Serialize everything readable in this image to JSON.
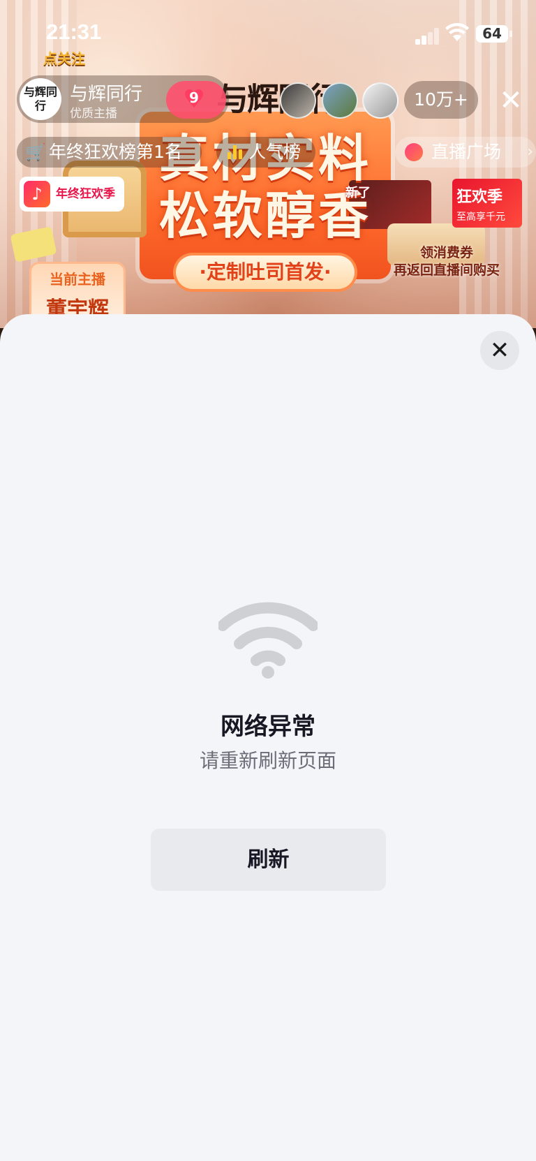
{
  "status_bar": {
    "time": "21:31",
    "battery": "64"
  },
  "live_header": {
    "follow_tag": "点关注",
    "host_name": "与辉同行",
    "host_subtitle": "优质主播",
    "avatar_text": "与辉同行",
    "like_count": "9",
    "viewer_count": "10万+",
    "close_icon": "close-icon"
  },
  "live_pills": {
    "rank": "年终狂欢榜第1名",
    "popularity": "人气榜",
    "plaza": "直播广场"
  },
  "stream_banner": {
    "brand": "与辉同行",
    "line1": "真材实料",
    "line2": "松软醇香",
    "tagline": "·定制吐司首发·",
    "douyin_badge": "年终狂欢季",
    "festival_title": "狂欢季",
    "festival_sub": "至高享千元",
    "new_tag": "新了",
    "promo_line1": "领消费券",
    "promo_line2": "再返回直播间购买",
    "host_card_label": "当前主播",
    "host_card_name": "董宇辉"
  },
  "error_sheet": {
    "title": "网络异常",
    "subtitle": "请重新刷新页面",
    "refresh_label": "刷新",
    "icon": "wifi-icon"
  },
  "colors": {
    "sheet_bg": "#f4f5f9",
    "button_bg": "#e9eaee",
    "icon_gray": "#cfd0d4",
    "accent_red": "#ff3d63"
  }
}
